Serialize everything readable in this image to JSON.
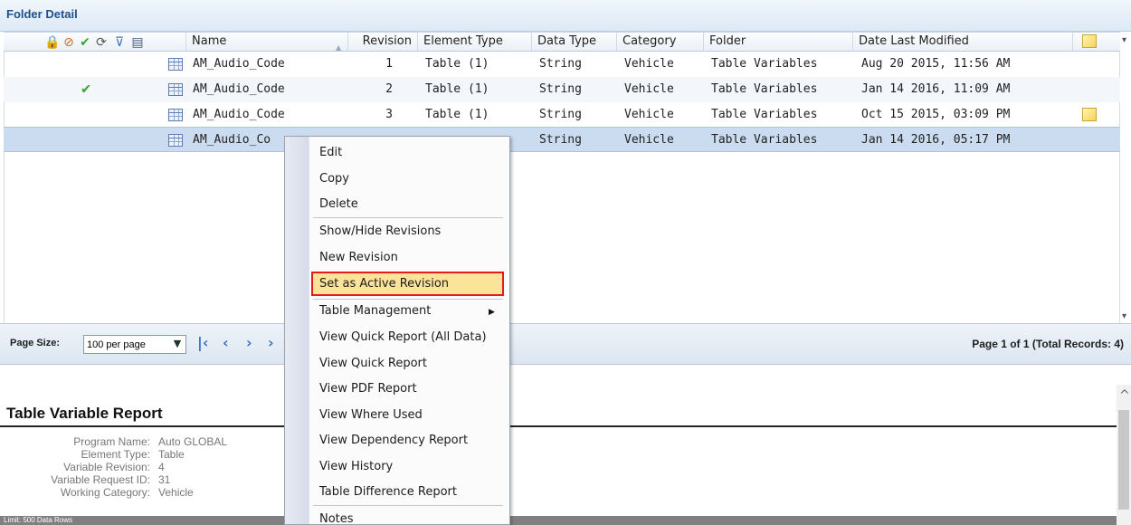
{
  "panel_title": "Folder Detail",
  "columns": {
    "name": "Name",
    "revision": "Revision",
    "element_type": "Element Type",
    "data_type": "Data Type",
    "category": "Category",
    "folder": "Folder",
    "date_modified": "Date Last Modified"
  },
  "rows": [
    {
      "name": "AM_Audio_Code",
      "revision": "1",
      "element_type": "Table (1)",
      "data_type": "String",
      "category": "Vehicle",
      "folder": "Table Variables",
      "date_modified": "Aug 20 2015, 11:56 AM",
      "active": false,
      "note": false
    },
    {
      "name": "AM_Audio_Code",
      "revision": "2",
      "element_type": "Table (1)",
      "data_type": "String",
      "category": "Vehicle",
      "folder": "Table Variables",
      "date_modified": "Jan 14 2016, 11:09 AM",
      "active": true,
      "note": false
    },
    {
      "name": "AM_Audio_Code",
      "revision": "3",
      "element_type": "Table (1)",
      "data_type": "String",
      "category": "Vehicle",
      "folder": "Table Variables",
      "date_modified": "Oct 15 2015, 03:09 PM",
      "active": false,
      "note": true
    },
    {
      "name": "AM_Audio_Co",
      "revision": "",
      "element_type": "",
      "data_type": "String",
      "category": "Vehicle",
      "folder": "Table Variables",
      "date_modified": "Jan 14 2016, 05:17 PM",
      "active": false,
      "note": false
    }
  ],
  "pager": {
    "page_size_label": "Page Size:",
    "page_size_value": "100 per page",
    "page_info": "Page 1 of 1 (Total Records: 4)"
  },
  "context_menu": {
    "items": [
      "Edit",
      "Copy",
      "Delete",
      "Show/Hide Revisions",
      "New Revision",
      "Set as Active Revision",
      "Table Management",
      "View Quick Report (All Data)",
      "View Quick Report",
      "View PDF Report",
      "View Where Used",
      "View Dependency Report",
      "View History",
      "Table Difference Report",
      "Notes"
    ],
    "highlighted": "Set as Active Revision"
  },
  "report": {
    "title": "Table Variable Report",
    "fields": [
      {
        "label": "Program Name:",
        "value": "Auto GLOBAL"
      },
      {
        "label": "Element Type:",
        "value": "Table"
      },
      {
        "label": "Variable Revision:",
        "value": "4"
      },
      {
        "label": "Variable Request ID:",
        "value": "31"
      },
      {
        "label": "Working Category:",
        "value": "Vehicle"
      }
    ],
    "limit_text": "Limit: 500 Data Rows"
  },
  "colors": {
    "title_text": "#1d4f8c",
    "selected_row": "#cbdcf0",
    "highlight_fill": "#fbe39a",
    "highlight_border": "#e31b1b",
    "check": "#3aa53a"
  }
}
